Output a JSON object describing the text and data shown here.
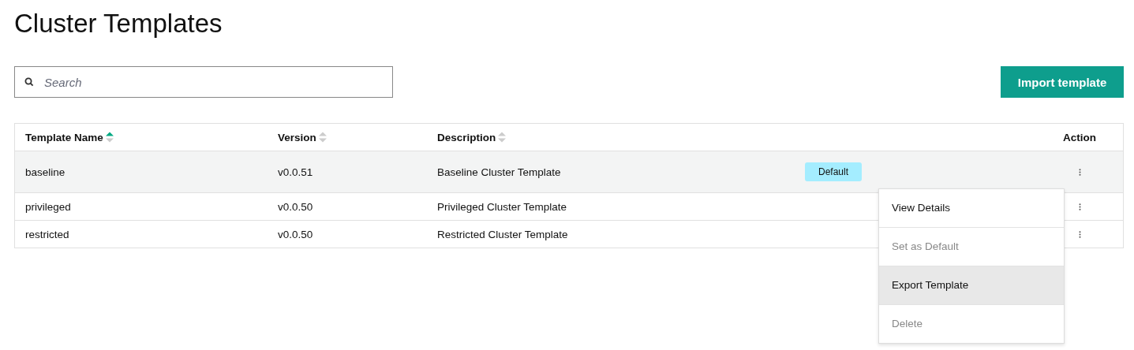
{
  "title": "Cluster Templates",
  "search": {
    "placeholder": "Search"
  },
  "import_button": "Import template",
  "table": {
    "columns": [
      {
        "label": "Template Name",
        "sortable": true,
        "sorted_ascending": true
      },
      {
        "label": "Version",
        "sortable": true,
        "sorted_ascending": false
      },
      {
        "label": "Description",
        "sortable": true,
        "sorted_ascending": false
      },
      {
        "label": "Action",
        "sortable": false
      }
    ],
    "rows": [
      {
        "name": "baseline",
        "version": "v0.0.51",
        "description": "Baseline Cluster Template",
        "badge": "Default",
        "selected": true
      },
      {
        "name": "privileged",
        "version": "v0.0.50",
        "description": "Privileged Cluster Template",
        "selected": false
      },
      {
        "name": "restricted",
        "version": "v0.0.50",
        "description": "Restricted Cluster Template",
        "selected": false
      }
    ]
  },
  "action_menu": {
    "items": [
      {
        "label": "View Details",
        "disabled": false,
        "highlighted": false
      },
      {
        "label": "Set as Default",
        "disabled": true,
        "highlighted": false
      },
      {
        "label": "Export Template",
        "disabled": false,
        "highlighted": true
      },
      {
        "label": "Delete",
        "disabled": true,
        "highlighted": false
      }
    ]
  }
}
